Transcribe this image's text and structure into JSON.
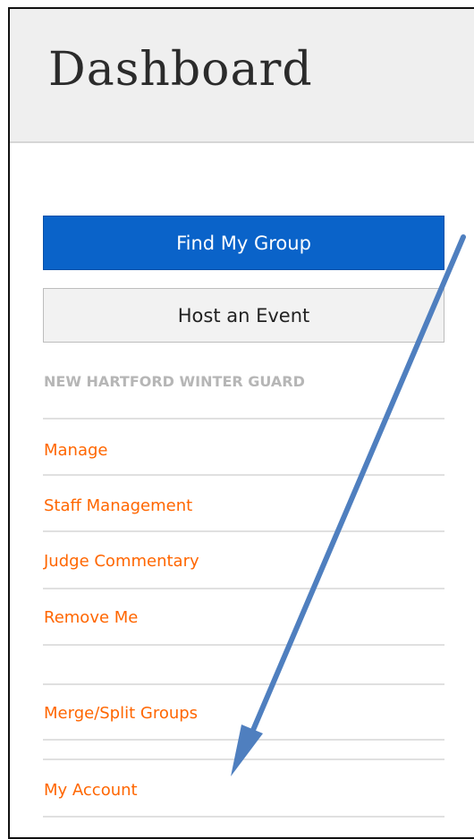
{
  "header": {
    "title": "Dashboard"
  },
  "actions": {
    "find_group": "Find My Group",
    "host_event": "Host an Event"
  },
  "group": {
    "name": "NEW HARTFORD WINTER GUARD",
    "links": [
      "Manage",
      "Staff Management",
      "Judge Commentary",
      "Remove Me"
    ]
  },
  "extra_links": {
    "merge_split": "Merge/Split Groups",
    "my_account": "My Account"
  },
  "colors": {
    "primary_button": "#0a63c9",
    "link": "#ff6600",
    "annotation_arrow": "#4f7fbf"
  }
}
